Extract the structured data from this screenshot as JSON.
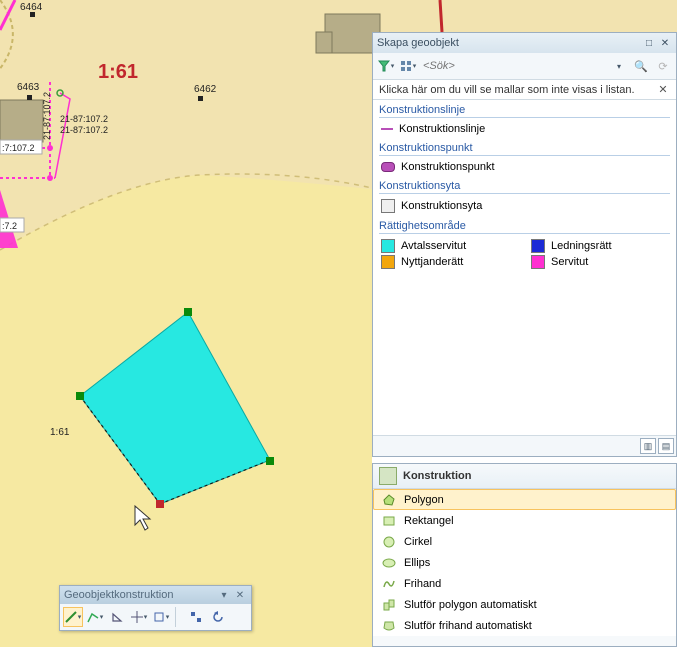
{
  "map": {
    "labels": {
      "a6464": "6464",
      "a6463": "6463",
      "a6462": "6462",
      "plan_big": "1:61",
      "axis1": "21-87:107.2",
      "box1": ":7:107.2",
      "box2": ":7.2",
      "poly_label": "1:61"
    }
  },
  "geotoolbar": {
    "title": "Geoobjektkonstruktion"
  },
  "skapa": {
    "title": "Skapa geoobjekt",
    "search_placeholder": "<Sök>",
    "hint": "Klicka här om du vill se mallar som inte visas i listan.",
    "groups": {
      "konstruktionslinje": {
        "header": "Konstruktionslinje",
        "item": "Konstruktionslinje"
      },
      "konstruktionspunkt": {
        "header": "Konstruktionspunkt",
        "item": "Konstruktionspunkt"
      },
      "konstruktionsyta": {
        "header": "Konstruktionsyta",
        "item": "Konstruktionsyta"
      },
      "rattighet": {
        "header": "Rättighetsområde",
        "avtal": "Avtalsservitut",
        "ledning": "Ledningsrätt",
        "nyttjande": "Nyttjanderätt",
        "servitut": "Servitut"
      }
    },
    "colors": {
      "avtal": "#27e8e1",
      "ledning": "#1b2ad6",
      "nyttjande": "#f2a60d",
      "servitut": "#ff2fd1"
    }
  },
  "konstruktion": {
    "title": "Konstruktion",
    "tools": [
      {
        "id": "polygon",
        "label": "Polygon",
        "selected": true
      },
      {
        "id": "rektangel",
        "label": "Rektangel",
        "selected": false
      },
      {
        "id": "cirkel",
        "label": "Cirkel",
        "selected": false
      },
      {
        "id": "ellips",
        "label": "Ellips",
        "selected": false
      },
      {
        "id": "frihand",
        "label": "Frihand",
        "selected": false
      },
      {
        "id": "slutfor-polygon",
        "label": "Slutför polygon automatiskt",
        "selected": false
      },
      {
        "id": "slutfor-frihand",
        "label": "Slutför frihand automatiskt",
        "selected": false
      }
    ]
  }
}
